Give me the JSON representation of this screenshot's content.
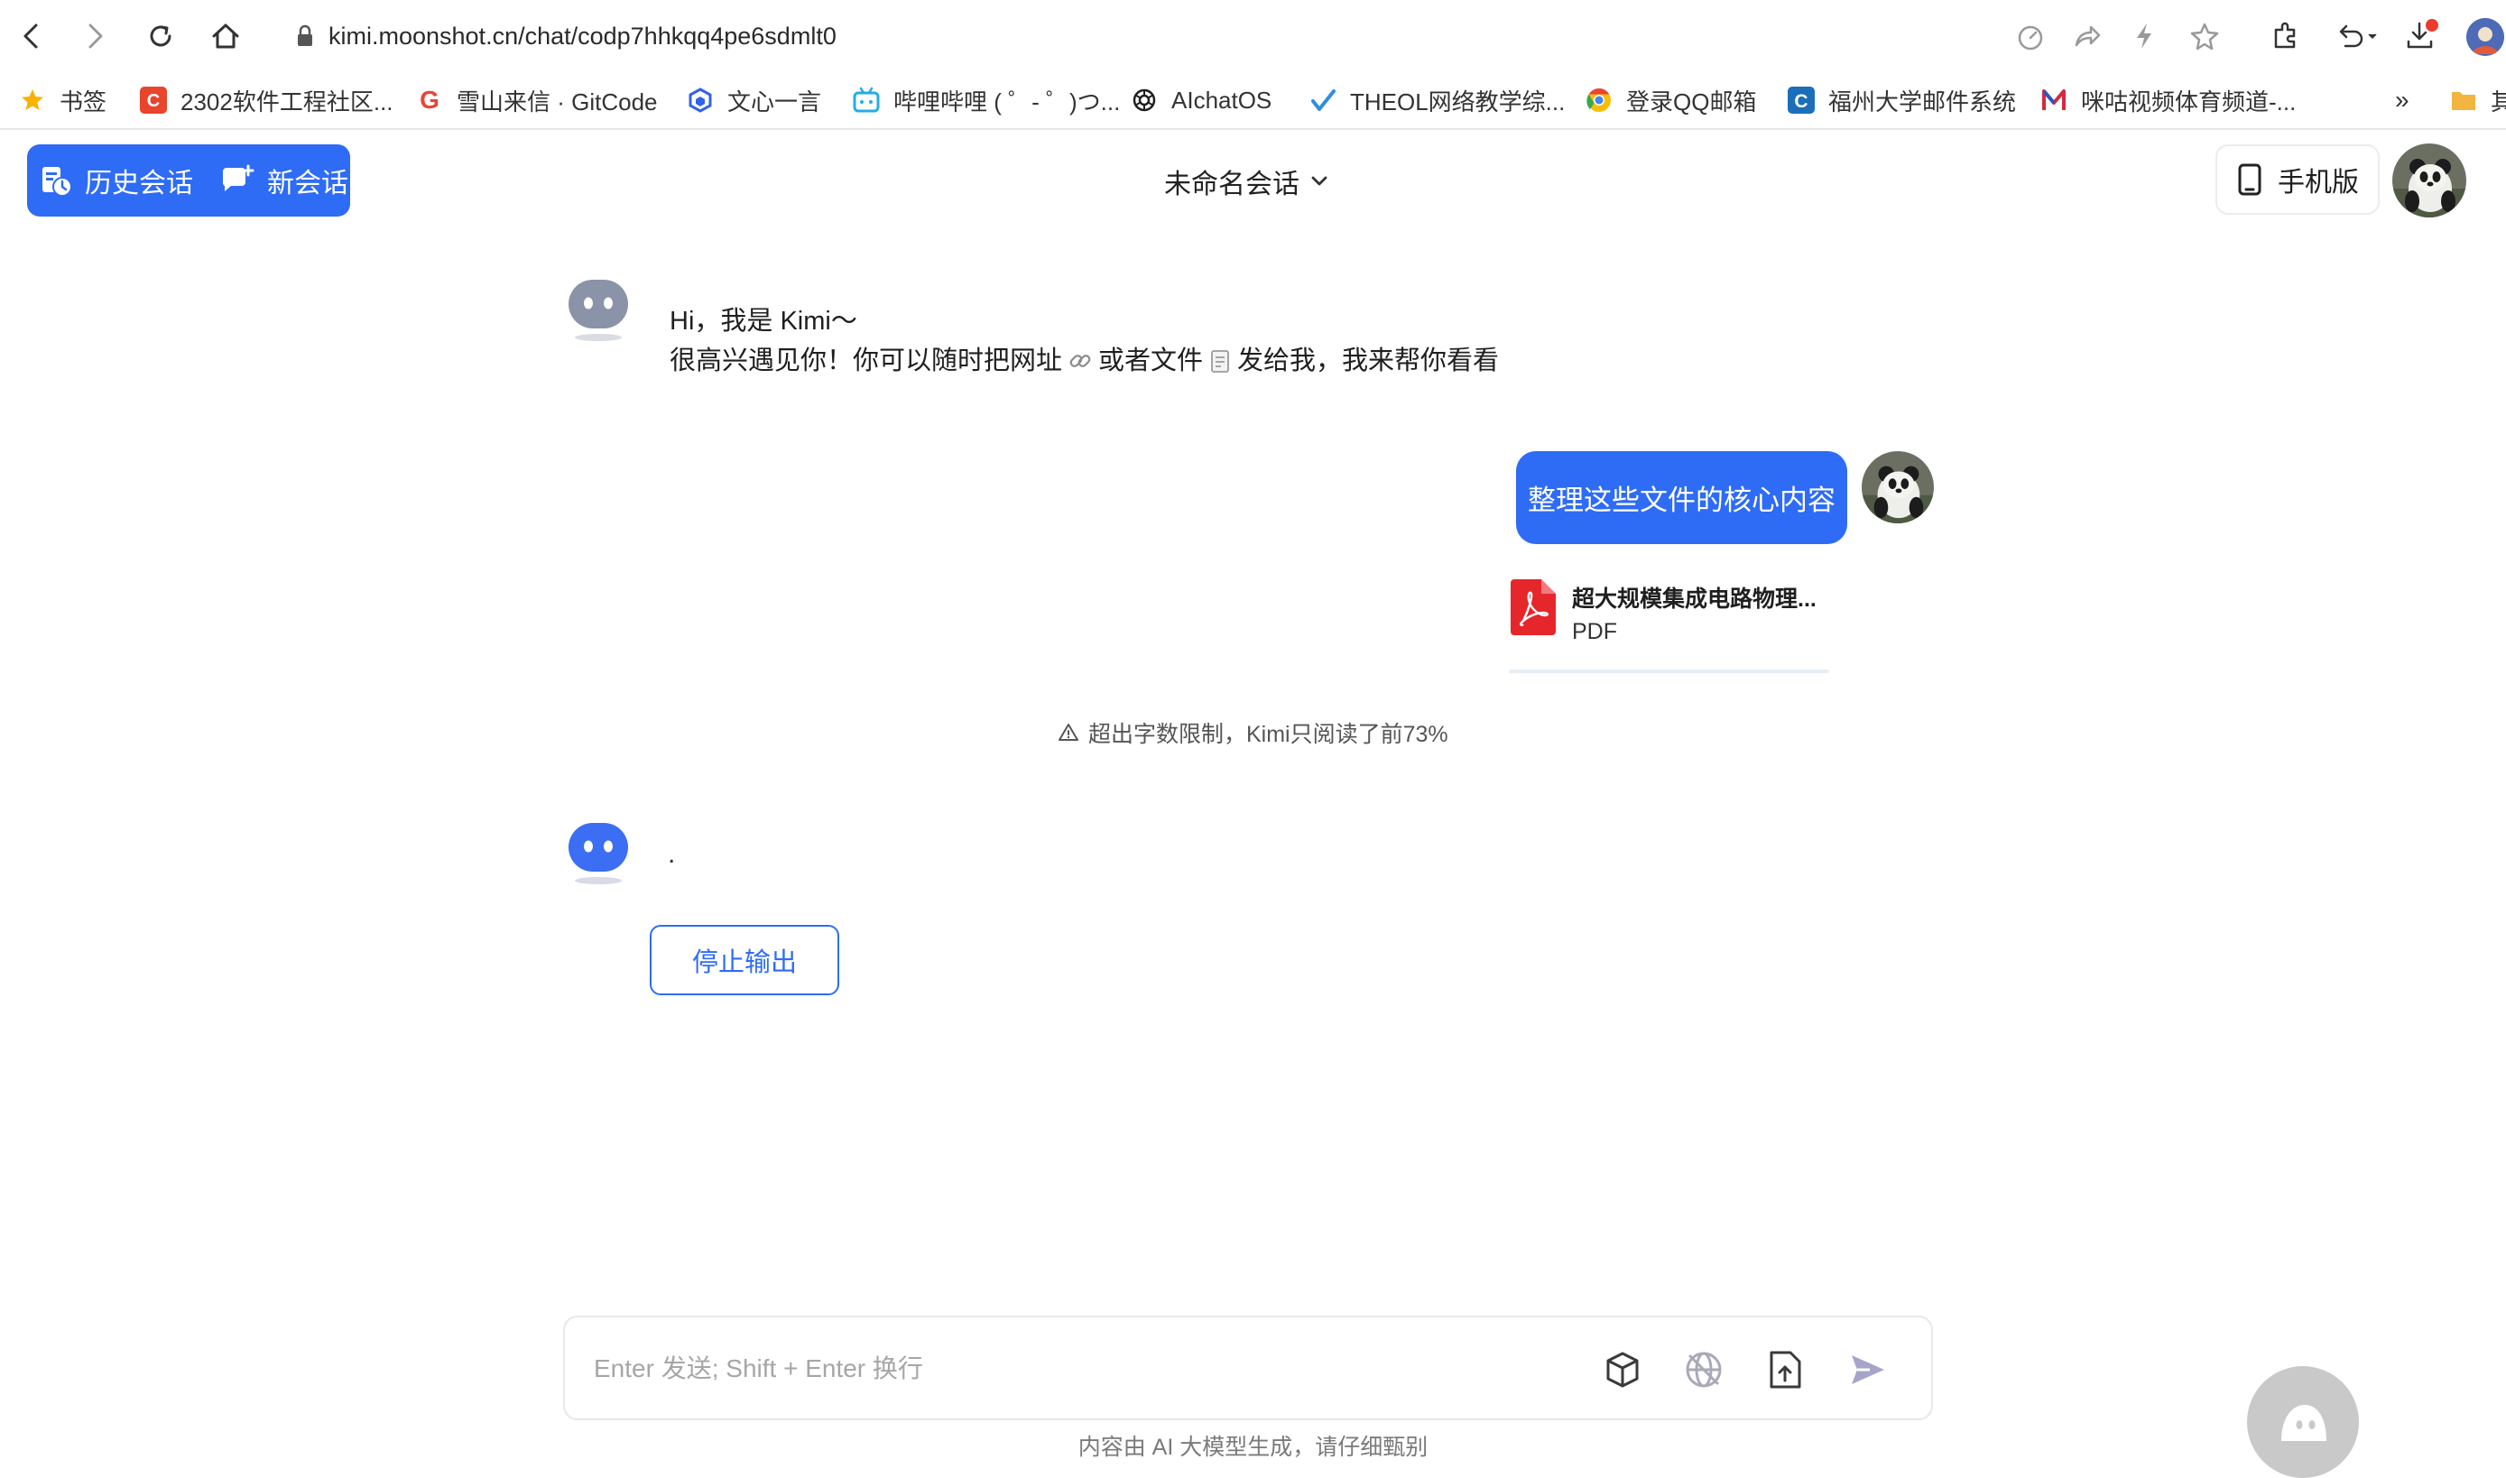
{
  "browser": {
    "url": "kimi.moonshot.cn/chat/codp7hhkqq4pe6sdmlt0",
    "bookmarks": [
      {
        "label": "书签",
        "icon": "star-icon",
        "color": "#f6b400"
      },
      {
        "label": "2302软件工程社区...",
        "icon": "csdn-icon",
        "color": "#e8452c"
      },
      {
        "label": "雪山来信 · GitCode",
        "icon": "google-icon",
        "color": "#ea4335"
      },
      {
        "label": "文心一言",
        "icon": "cube-logo-icon",
        "color": "#2f64e8"
      },
      {
        "label": "哔哩哔哩 ( ゜- ゜)つ...",
        "icon": "bilibili-icon",
        "color": "#23ade5"
      },
      {
        "label": "AIchatOS",
        "icon": "openai-icon",
        "color": "#1f1f1f"
      },
      {
        "label": "THEOL网络教学综...",
        "icon": "theol-icon",
        "color": "#2d8fe0"
      },
      {
        "label": "登录QQ邮箱",
        "icon": "chrome-icon",
        "color": "#fbbc05"
      },
      {
        "label": "福州大学邮件系统",
        "icon": "c-logo-icon",
        "color": "#1b6fb8"
      },
      {
        "label": "咪咕视频体育频道-...",
        "icon": "m-logo-icon",
        "color": "#d42a3c"
      },
      {
        "label": "其",
        "icon": "folder-icon",
        "color": "#f3b53f"
      }
    ],
    "overflow_label": "»"
  },
  "header": {
    "history_label": "历史会话",
    "new_label": "新会话",
    "title": "未命名会话",
    "mobile_label": "手机版"
  },
  "chat": {
    "greeting_line1": "Hi，我是 Kimi～",
    "greeting_line2_a": "很高兴遇见你！你可以随时把网址",
    "greeting_line2_b": "或者文件",
    "greeting_line2_c": "发给我，我来帮你看看",
    "user_message": "整理这些文件的核心内容",
    "file_name": "超大规模集成电路物理...",
    "file_type": "PDF",
    "warning": "超出字数限制，Kimi只阅读了前73%",
    "reply": ".",
    "stop_label": "停止输出"
  },
  "input": {
    "placeholder": "Enter 发送; Shift + Enter 换行",
    "value": ""
  },
  "footer": {
    "note": "内容由 AI 大模型生成，请仔细甄别"
  },
  "colors": {
    "accent": "#2e6cf5",
    "pdf": "#e5262b"
  }
}
